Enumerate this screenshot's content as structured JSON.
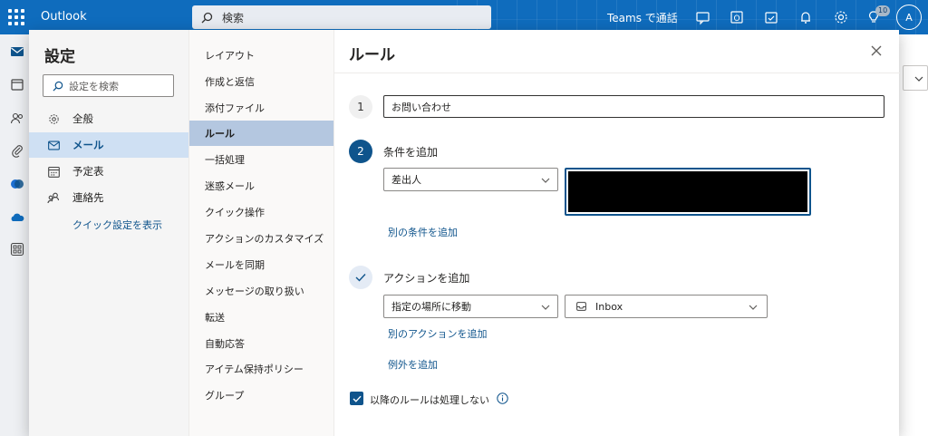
{
  "topbar": {
    "app_name": "Outlook",
    "search_placeholder": "検索",
    "teams_label": "Teams で通話",
    "notification_count": "10",
    "avatar_initial": "A"
  },
  "settings": {
    "title": "設定",
    "search_placeholder": "設定を検索",
    "categories": [
      {
        "label": "全般",
        "icon": "gear-icon"
      },
      {
        "label": "メール",
        "icon": "mail-icon"
      },
      {
        "label": "予定表",
        "icon": "calendar-icon"
      },
      {
        "label": "連絡先",
        "icon": "people-icon"
      }
    ],
    "active_category": "メール",
    "quick_settings_link": "クイック設定を表示"
  },
  "mail_menu": {
    "items": [
      "レイアウト",
      "作成と返信",
      "添付ファイル",
      "ルール",
      "一括処理",
      "迷惑メール",
      "クイック操作",
      "アクションのカスタマイズ",
      "メールを同期",
      "メッセージの取り扱い",
      "転送",
      "自動応答",
      "アイテム保持ポリシー",
      "グループ"
    ],
    "active_item": "ルール"
  },
  "rule": {
    "title": "ルール",
    "step1_number": "1",
    "rule_name": "お問い合わせ",
    "step2_number": "2",
    "condition_heading": "条件を追加",
    "condition_select": "差出人",
    "add_condition_link": "別の条件を追加",
    "action_heading": "アクションを追加",
    "action_select": "指定の場所に移動",
    "folder_select": "Inbox",
    "add_action_link": "別のアクションを追加",
    "add_exception_link": "例外を追加",
    "stop_processing_label": "以降のルールは処理しない",
    "stop_processing_checked": true
  },
  "colors": {
    "brand": "#0f6cbd",
    "accent": "#0f548c",
    "selected_bg": "#cfe0f3"
  }
}
